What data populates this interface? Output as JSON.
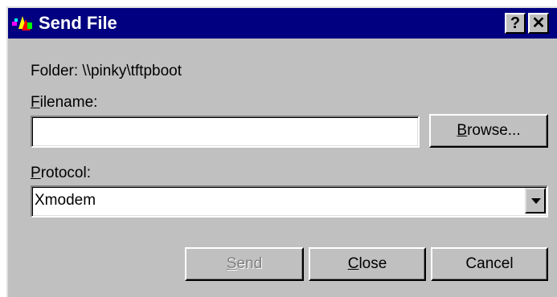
{
  "window": {
    "title": "Send File",
    "help_label": "?",
    "close_label": "✕",
    "icon": "send-file-app-icon"
  },
  "folder": {
    "text": "Folder:  \\\\pinky\\tftpboot"
  },
  "filename": {
    "label_mnemonic": "F",
    "label_rest": "ilename:",
    "value": ""
  },
  "browse_button": {
    "mnemonic": "B",
    "rest": "rowse..."
  },
  "protocol": {
    "label_mnemonic": "P",
    "label_rest": "rotocol:",
    "selected": "Xmodem"
  },
  "buttons": {
    "send_mnemonic": "S",
    "send_rest": "end",
    "close_mnemonic": "C",
    "close_rest": "lose",
    "cancel": "Cancel"
  },
  "colors": {
    "titlebar": "#000080",
    "face": "#c0c0c0",
    "disabled_text": "#808080"
  }
}
